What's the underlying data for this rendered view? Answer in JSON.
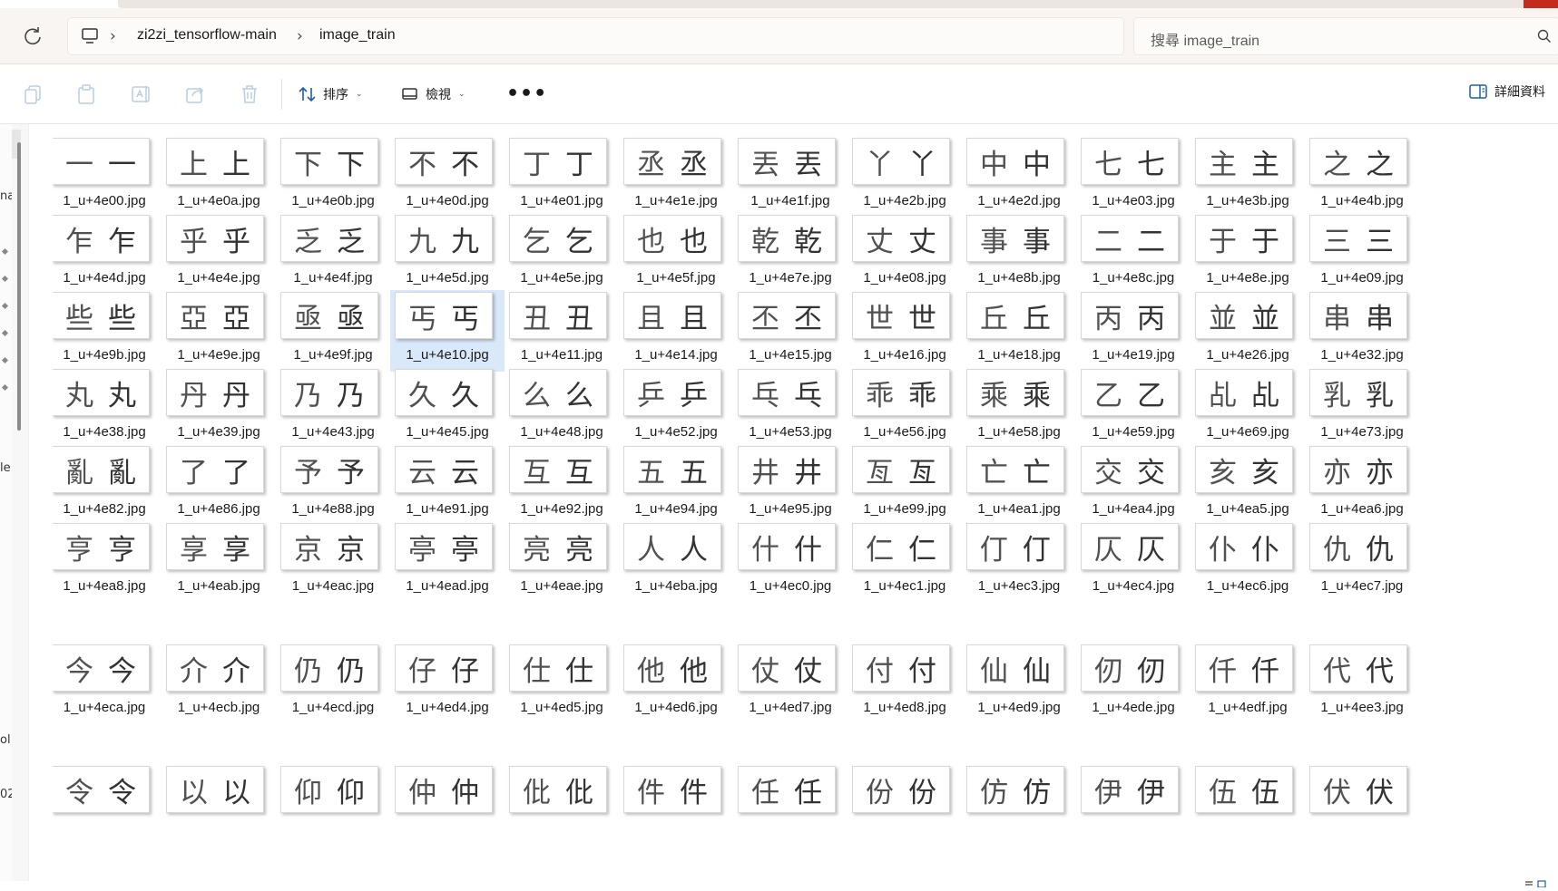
{
  "breadcrumb": [
    "zi2zi_tensorflow-main",
    "image_train"
  ],
  "search": {
    "placeholder": "搜尋 image_train"
  },
  "toolbar": {
    "sort_label": "排序",
    "view_label": "檢視",
    "more_label": "•••",
    "details_label": "詳細資料"
  },
  "left_fragments": [
    "na",
    "le",
    "ol",
    "02"
  ],
  "selected_file": "1_u+4e10.jpg",
  "rows": [
    [
      {
        "c": "一",
        "f": "1_u+4e00.jpg"
      },
      {
        "c": "上",
        "f": "1_u+4e0a.jpg"
      },
      {
        "c": "下",
        "f": "1_u+4e0b.jpg"
      },
      {
        "c": "不",
        "f": "1_u+4e0d.jpg"
      },
      {
        "c": "丁",
        "f": "1_u+4e01.jpg"
      },
      {
        "c": "丞",
        "f": "1_u+4e1e.jpg"
      },
      {
        "c": "丟",
        "f": "1_u+4e1f.jpg"
      },
      {
        "c": "丫",
        "f": "1_u+4e2b.jpg"
      },
      {
        "c": "中",
        "f": "1_u+4e2d.jpg"
      },
      {
        "c": "七",
        "f": "1_u+4e03.jpg"
      },
      {
        "c": "主",
        "f": "1_u+4e3b.jpg"
      },
      {
        "c": "之",
        "f": "1_u+4e4b.jpg"
      }
    ],
    [
      {
        "c": "乍",
        "f": "1_u+4e4d.jpg"
      },
      {
        "c": "乎",
        "f": "1_u+4e4e.jpg"
      },
      {
        "c": "乏",
        "f": "1_u+4e4f.jpg"
      },
      {
        "c": "九",
        "f": "1_u+4e5d.jpg"
      },
      {
        "c": "乞",
        "f": "1_u+4e5e.jpg"
      },
      {
        "c": "也",
        "f": "1_u+4e5f.jpg"
      },
      {
        "c": "乾",
        "f": "1_u+4e7e.jpg"
      },
      {
        "c": "丈",
        "f": "1_u+4e08.jpg"
      },
      {
        "c": "事",
        "f": "1_u+4e8b.jpg"
      },
      {
        "c": "二",
        "f": "1_u+4e8c.jpg"
      },
      {
        "c": "于",
        "f": "1_u+4e8e.jpg"
      },
      {
        "c": "三",
        "f": "1_u+4e09.jpg"
      }
    ],
    [
      {
        "c": "些",
        "f": "1_u+4e9b.jpg"
      },
      {
        "c": "亞",
        "f": "1_u+4e9e.jpg"
      },
      {
        "c": "亟",
        "f": "1_u+4e9f.jpg"
      },
      {
        "c": "丐",
        "f": "1_u+4e10.jpg"
      },
      {
        "c": "丑",
        "f": "1_u+4e11.jpg"
      },
      {
        "c": "且",
        "f": "1_u+4e14.jpg"
      },
      {
        "c": "丕",
        "f": "1_u+4e15.jpg"
      },
      {
        "c": "世",
        "f": "1_u+4e16.jpg"
      },
      {
        "c": "丘",
        "f": "1_u+4e18.jpg"
      },
      {
        "c": "丙",
        "f": "1_u+4e19.jpg"
      },
      {
        "c": "並",
        "f": "1_u+4e26.jpg"
      },
      {
        "c": "串",
        "f": "1_u+4e32.jpg"
      }
    ],
    [
      {
        "c": "丸",
        "f": "1_u+4e38.jpg"
      },
      {
        "c": "丹",
        "f": "1_u+4e39.jpg"
      },
      {
        "c": "乃",
        "f": "1_u+4e43.jpg"
      },
      {
        "c": "久",
        "f": "1_u+4e45.jpg"
      },
      {
        "c": "么",
        "f": "1_u+4e48.jpg"
      },
      {
        "c": "乒",
        "f": "1_u+4e52.jpg"
      },
      {
        "c": "乓",
        "f": "1_u+4e53.jpg"
      },
      {
        "c": "乖",
        "f": "1_u+4e56.jpg"
      },
      {
        "c": "乘",
        "f": "1_u+4e58.jpg"
      },
      {
        "c": "乙",
        "f": "1_u+4e59.jpg"
      },
      {
        "c": "乩",
        "f": "1_u+4e69.jpg"
      },
      {
        "c": "乳",
        "f": "1_u+4e73.jpg"
      }
    ],
    [
      {
        "c": "亂",
        "f": "1_u+4e82.jpg"
      },
      {
        "c": "了",
        "f": "1_u+4e86.jpg"
      },
      {
        "c": "予",
        "f": "1_u+4e88.jpg"
      },
      {
        "c": "云",
        "f": "1_u+4e91.jpg"
      },
      {
        "c": "互",
        "f": "1_u+4e92.jpg"
      },
      {
        "c": "五",
        "f": "1_u+4e94.jpg"
      },
      {
        "c": "井",
        "f": "1_u+4e95.jpg"
      },
      {
        "c": "亙",
        "f": "1_u+4e99.jpg"
      },
      {
        "c": "亡",
        "f": "1_u+4ea1.jpg"
      },
      {
        "c": "交",
        "f": "1_u+4ea4.jpg"
      },
      {
        "c": "亥",
        "f": "1_u+4ea5.jpg"
      },
      {
        "c": "亦",
        "f": "1_u+4ea6.jpg"
      }
    ],
    [
      {
        "c": "亨",
        "f": "1_u+4ea8.jpg"
      },
      {
        "c": "享",
        "f": "1_u+4eab.jpg"
      },
      {
        "c": "京",
        "f": "1_u+4eac.jpg"
      },
      {
        "c": "亭",
        "f": "1_u+4ead.jpg"
      },
      {
        "c": "亮",
        "f": "1_u+4eae.jpg"
      },
      {
        "c": "人",
        "f": "1_u+4eba.jpg"
      },
      {
        "c": "什",
        "f": "1_u+4ec0.jpg"
      },
      {
        "c": "仁",
        "f": "1_u+4ec1.jpg"
      },
      {
        "c": "仃",
        "f": "1_u+4ec3.jpg"
      },
      {
        "c": "仄",
        "f": "1_u+4ec4.jpg"
      },
      {
        "c": "仆",
        "f": "1_u+4ec6.jpg"
      },
      {
        "c": "仇",
        "f": "1_u+4ec7.jpg"
      }
    ],
    [
      {
        "c": "今",
        "f": "1_u+4eca.jpg"
      },
      {
        "c": "介",
        "f": "1_u+4ecb.jpg"
      },
      {
        "c": "仍",
        "f": "1_u+4ecd.jpg"
      },
      {
        "c": "仔",
        "f": "1_u+4ed4.jpg"
      },
      {
        "c": "仕",
        "f": "1_u+4ed5.jpg"
      },
      {
        "c": "他",
        "f": "1_u+4ed6.jpg"
      },
      {
        "c": "仗",
        "f": "1_u+4ed7.jpg"
      },
      {
        "c": "付",
        "f": "1_u+4ed8.jpg"
      },
      {
        "c": "仙",
        "f": "1_u+4ed9.jpg"
      },
      {
        "c": "仞",
        "f": "1_u+4ede.jpg"
      },
      {
        "c": "仟",
        "f": "1_u+4edf.jpg"
      },
      {
        "c": "代",
        "f": "1_u+4ee3.jpg"
      }
    ],
    [
      {
        "c": "令",
        "f": ""
      },
      {
        "c": "以",
        "f": ""
      },
      {
        "c": "仰",
        "f": ""
      },
      {
        "c": "仲",
        "f": ""
      },
      {
        "c": "仳",
        "f": ""
      },
      {
        "c": "件",
        "f": ""
      },
      {
        "c": "任",
        "f": ""
      },
      {
        "c": "份",
        "f": ""
      },
      {
        "c": "仿",
        "f": ""
      },
      {
        "c": "伊",
        "f": ""
      },
      {
        "c": "伍",
        "f": ""
      },
      {
        "c": "伏",
        "f": ""
      }
    ]
  ]
}
